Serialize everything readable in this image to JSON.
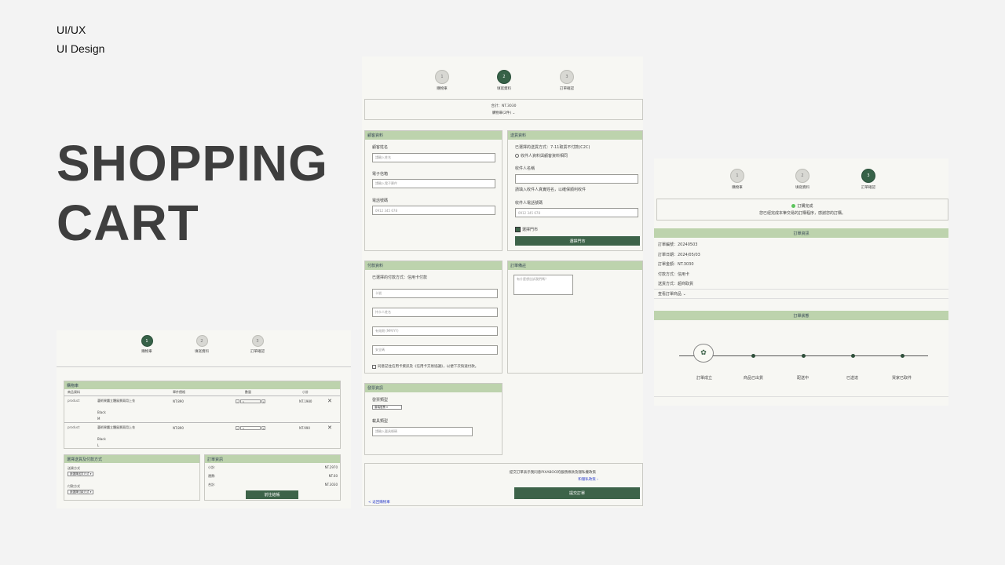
{
  "header": {
    "line1": "UI/UX",
    "line2": "UI  Design"
  },
  "hero": {
    "line1": "SHOPPING",
    "line2": "CART"
  },
  "steps": [
    {
      "num": "1",
      "label": "購物車"
    },
    {
      "num": "2",
      "label": "填寫資料"
    },
    {
      "num": "3",
      "label": "訂單確認"
    }
  ],
  "cart": {
    "section_title": "購物車",
    "columns": [
      "商品資料",
      "單件價格",
      "數量",
      "小計"
    ],
    "rows": [
      {
        "img_alt": "product",
        "name": "藝術果醬立體風景兩用上衣",
        "color": "Black",
        "size": "M",
        "price": "NT.890",
        "qty": "1",
        "subtotal": "NT.1980"
      },
      {
        "img_alt": "product",
        "name": "藝術果醬立體風景兩用上衣",
        "color": "Black",
        "size": "L",
        "price": "NT.890",
        "qty": "1",
        "subtotal": "NT.990"
      }
    ],
    "remove_icon": "close-icon",
    "shipping_section": {
      "title": "選擇送貨及付款方式",
      "ship_label": "送貨方式",
      "ship_select": "請選擇送貨方式",
      "pay_label": "付款方式",
      "pay_select": "請選擇付款方式"
    },
    "summary": {
      "title": "訂單資訊",
      "subtotal_label": "小計:",
      "subtotal_value": "NT.2970",
      "shipping_label": "運費:",
      "shipping_value": "NT.60",
      "total_label": "合計:",
      "total_value": "NT.3030",
      "checkout_label": "前往結帳"
    }
  },
  "checkout": {
    "total_line": "合計：NT.3030",
    "cart_toggle": "購物車(2件)",
    "customer": {
      "title": "顧客資料",
      "name_label": "顧客姓名",
      "name_ph": "請輸入姓名",
      "email_label": "電子信箱",
      "email_ph": "請輸入電子郵件",
      "phone_label": "電話號碼",
      "phone_ph": "0912 345 678"
    },
    "delivery": {
      "title": "送貨資料",
      "method_line": "已選擇的送貨方式：7-11取貨不付款(C2C)",
      "same_as": "收件人資料與顧客資料相同",
      "recv_name_label": "收件人名稱",
      "recv_note": "請填入收件人真實姓名，以確保順利收件",
      "recv_phone_label": "收件人電話號碼",
      "recv_phone_ph": "0912 345 678",
      "store_label": "選擇門市",
      "store_button": "選擇門市"
    },
    "payment": {
      "title": "付款資料",
      "method_line": "已選擇的付款方式：信用卡付款",
      "card_ph": "卡號",
      "holder_ph": "持卡人姓名",
      "expiry_ph": "有效期 (MM/YY)",
      "cvc_ph": "安全碼",
      "remember": "同意記住信用卡資訊及《信用卡交易協議》，以便下次快速付款。"
    },
    "remark": {
      "title": "訂單備註",
      "ph": "有什麼想告訴我們嗎？"
    },
    "invoice": {
      "title": "發票資訊",
      "type_label": "發票類型",
      "type_select": "雲端發票",
      "carrier_label": "載具類型",
      "carrier_ph": "請輸入載具條碼"
    },
    "footer": {
      "agree_text": "提交訂單表示我同意PIXABOO的服務條款及隱私權政策",
      "policy_link": "和隱私政策",
      "submit": "提交訂單",
      "back": "< 返回購物車"
    }
  },
  "confirm": {
    "success_title": "訂購完成",
    "success_sub": "您已經完成本筆交易的訂購程序，感謝您的訂購。",
    "info": {
      "title": "訂單資訊",
      "items": [
        "訂單編號：20240503",
        "訂單日期：2024/05/03",
        "訂單金額：NT.3030",
        "付款方式：信用卡",
        "送貨方式：超商取貨"
      ],
      "toggle": "查看訂單商品"
    },
    "status": {
      "title": "訂單狀態",
      "stages": [
        "訂單成立",
        "商品已出貨",
        "配送中",
        "已送達",
        "買家已取件"
      ]
    }
  },
  "colors": {
    "accent": "#376248",
    "section_head": "#bdd3ad",
    "panel_bg": "#f7f7f3"
  }
}
